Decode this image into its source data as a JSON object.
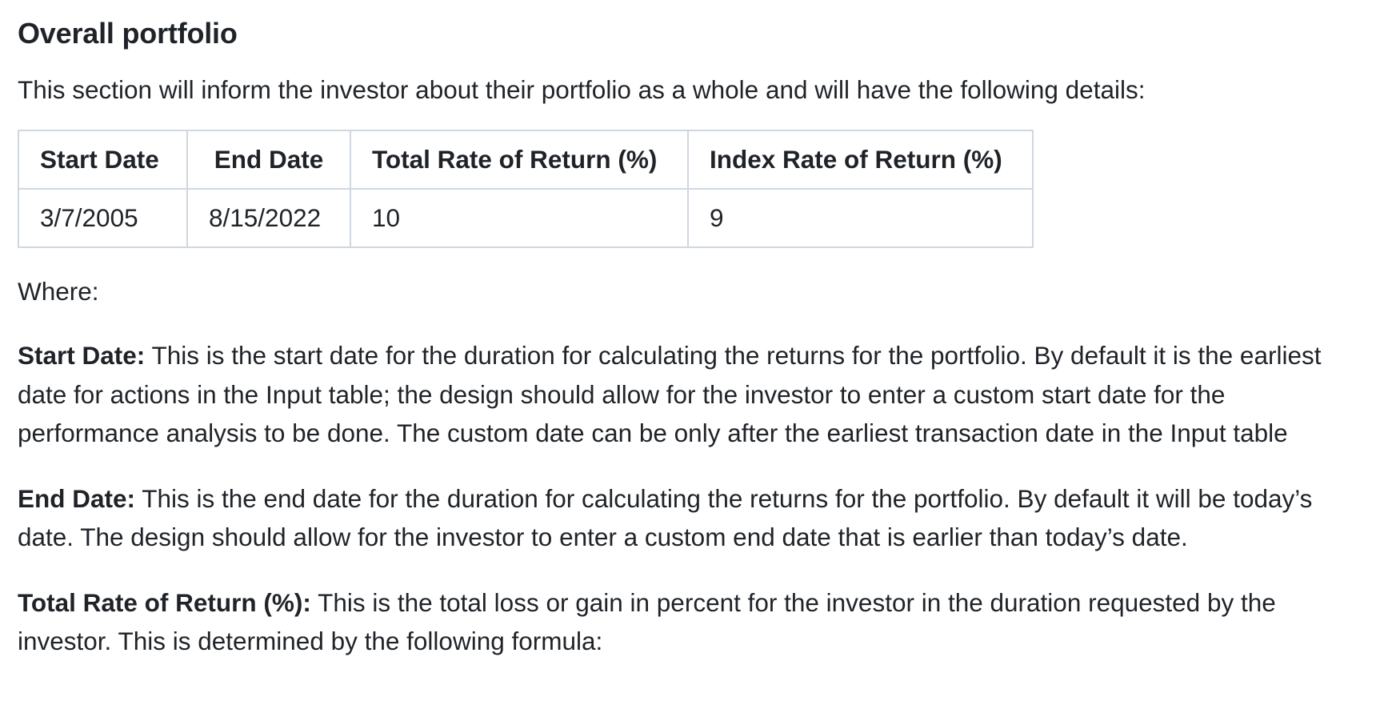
{
  "section": {
    "title": "Overall portfolio",
    "intro": "This section will inform the investor about their portfolio as a whole and will have the following details:"
  },
  "table": {
    "headers": [
      "Start Date",
      "End Date",
      "Total Rate of Return (%)",
      "Index Rate of Return (%)"
    ],
    "rows": [
      [
        "3/7/2005",
        "8/15/2022",
        "10",
        "9"
      ]
    ]
  },
  "where_label": "Where:",
  "definitions": [
    {
      "term": "Start Date:",
      "text": " This is the start date for the duration for calculating the returns for the portfolio. By default it is the earliest date for actions in the Input table; the design should allow for the investor to enter a custom start date for the performance analysis to be done. The custom date can be only after the earliest transaction date in the Input table"
    },
    {
      "term": "End Date:",
      "text": " This is the end date for the duration for calculating the returns for the portfolio. By default it will be today’s date. The design should allow for the investor to enter a custom end date that is earlier than today’s date."
    },
    {
      "term": "Total Rate of Return (%):",
      "text": " This is the total loss or gain in percent for the investor in the duration requested by the investor. This is determined by the following formula:"
    }
  ]
}
